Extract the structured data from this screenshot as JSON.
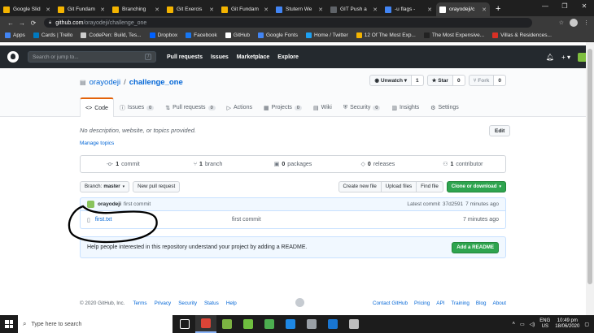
{
  "browser": {
    "tabs": [
      {
        "title": "Google Slid",
        "color": "#f4b400",
        "active": false
      },
      {
        "title": "Git Fundam",
        "color": "#f4b400",
        "active": false
      },
      {
        "title": "Branching",
        "color": "#f4b400",
        "active": false
      },
      {
        "title": "Git Exercis",
        "color": "#f4b400",
        "active": false
      },
      {
        "title": "Git Fundam",
        "color": "#f4b400",
        "active": false
      },
      {
        "title": "Stutern We",
        "color": "#4285f4",
        "active": false
      },
      {
        "title": "GIT Push a",
        "color": "#5f6368",
        "active": false
      },
      {
        "title": "-u flags -",
        "color": "#4285f4",
        "active": false
      },
      {
        "title": "orayodeji/c",
        "color": "#ffffff",
        "active": true
      }
    ],
    "url_host": "github.com",
    "url_path": "/orayodeji/challenge_one",
    "bookmarks": [
      {
        "label": "Apps",
        "color": "#4285f4"
      },
      {
        "label": "Cards | Trello",
        "color": "#0079bf"
      },
      {
        "label": "CodePen: Build, Tes...",
        "color": "#cccccc"
      },
      {
        "label": "Dropbox",
        "color": "#0061ff"
      },
      {
        "label": "Facebook",
        "color": "#1877f2"
      },
      {
        "label": "GitHub",
        "color": "#ffffff"
      },
      {
        "label": "Google Fonts",
        "color": "#4285f4"
      },
      {
        "label": "Home / Twitter",
        "color": "#1da1f2"
      },
      {
        "label": "12 Of The Most Exp...",
        "color": "#f4b400"
      },
      {
        "label": "The Most Expensive...",
        "color": "#222222"
      },
      {
        "label": "Villas & Residences...",
        "color": "#d93025"
      }
    ]
  },
  "github": {
    "search_placeholder": "Search or jump to...",
    "search_key": "/",
    "nav": [
      "Pull requests",
      "Issues",
      "Marketplace",
      "Explore"
    ],
    "owner": "orayodeji",
    "separator": "/",
    "repo": "challenge_one",
    "watch_label": "Unwatch",
    "watch_count": "1",
    "star_label": "Star",
    "star_count": "0",
    "fork_label": "Fork",
    "fork_count": "0",
    "tabs": [
      {
        "label": "Code",
        "icon": "<>",
        "count": "",
        "selected": true
      },
      {
        "label": "Issues",
        "icon": "ⓘ",
        "count": "0",
        "selected": false
      },
      {
        "label": "Pull requests",
        "icon": "⇅",
        "count": "0",
        "selected": false
      },
      {
        "label": "Actions",
        "icon": "▷",
        "count": "",
        "selected": false
      },
      {
        "label": "Projects",
        "icon": "▦",
        "count": "0",
        "selected": false
      },
      {
        "label": "Wiki",
        "icon": "▤",
        "count": "",
        "selected": false
      },
      {
        "label": "Security",
        "icon": "⛨",
        "count": "0",
        "selected": false
      },
      {
        "label": "Insights",
        "icon": "▥",
        "count": "",
        "selected": false
      },
      {
        "label": "Settings",
        "icon": "⚙",
        "count": "",
        "selected": false
      }
    ],
    "description": "No description, website, or topics provided.",
    "manage_topics": "Manage topics",
    "edit_label": "Edit",
    "numbers": [
      {
        "icon": "-o-",
        "value": "1",
        "label": "commit"
      },
      {
        "icon": "⑂",
        "value": "1",
        "label": "branch"
      },
      {
        "icon": "▣",
        "value": "0",
        "label": "packages"
      },
      {
        "icon": "◇",
        "value": "0",
        "label": "releases"
      },
      {
        "icon": "⚇",
        "value": "1",
        "label": "contributor"
      }
    ],
    "branch_prefix": "Branch:",
    "branch_name": "master",
    "new_pr_label": "New pull request",
    "create_file_label": "Create new file",
    "upload_label": "Upload files",
    "find_label": "Find file",
    "clone_label": "Clone or download",
    "commit_author": "orayodeji",
    "commit_message": "first commit",
    "latest_commit_label": "Latest commit",
    "commit_sha": "37d2591",
    "commit_age": "7 minutes ago",
    "files": [
      {
        "name": "first.txt",
        "message": "first commit",
        "age": "7 minutes ago"
      }
    ],
    "readme_prompt": "Help people interested in this repository understand your project by adding a README.",
    "add_readme_label": "Add a README",
    "footer": {
      "copyright": "© 2020 GitHub, Inc.",
      "left_links": [
        "Terms",
        "Privacy",
        "Security",
        "Status",
        "Help"
      ],
      "right_links": [
        "Contact GitHub",
        "Pricing",
        "API",
        "Training",
        "Blog",
        "About"
      ]
    }
  },
  "taskbar": {
    "search_placeholder": "Type here to search",
    "apps": [
      {
        "name": "task-view",
        "color": "#ffffff",
        "active": false
      },
      {
        "name": "chrome",
        "color": "#db4437",
        "active": true
      },
      {
        "name": "notepad",
        "color": "#7cb342",
        "active": false
      },
      {
        "name": "git",
        "color": "#6fbf3f",
        "active": false
      },
      {
        "name": "git-bash",
        "color": "#4caf50",
        "active": false
      },
      {
        "name": "vscode",
        "color": "#1e88e5",
        "active": false
      },
      {
        "name": "terminal",
        "color": "#9aa0a6",
        "active": false
      },
      {
        "name": "edge",
        "color": "#1976d2",
        "active": false
      },
      {
        "name": "app",
        "color": "#bdbdbd",
        "active": false
      }
    ],
    "lang_top": "ENG",
    "lang_bottom": "US",
    "time": "10:49 pm",
    "date": "18/06/2020"
  }
}
